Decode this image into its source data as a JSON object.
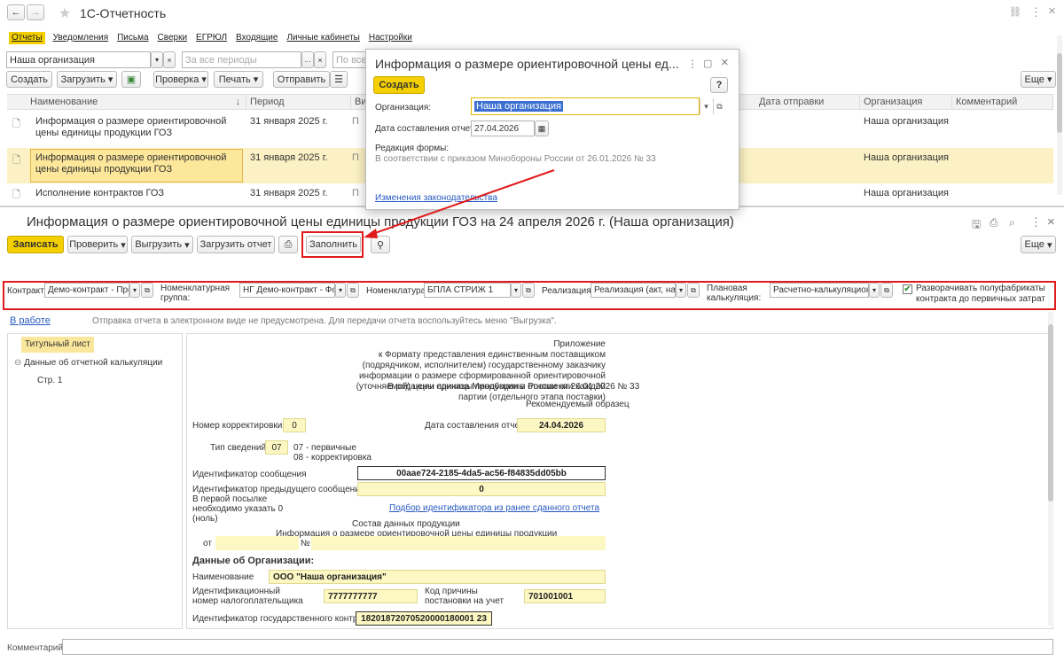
{
  "window": {
    "title": "1С-Отчетность",
    "nav_back": "←",
    "nav_forward": "→",
    "star": "★",
    "link_icon": "🔗",
    "more": "⋮",
    "close": "×"
  },
  "menu": [
    "Отчеты",
    "Уведомления",
    "Письма",
    "Сверки",
    "ЕГРЮЛ",
    "Входящие",
    "Личные кабинеты",
    "Настройки"
  ],
  "filters": {
    "org_value": "Наша организация",
    "period_placeholder": "За все периоды",
    "third_placeholder": "По всем"
  },
  "toolbar": {
    "create": "Создать",
    "load": "Загрузить",
    "check": "Проверка",
    "print": "Печать",
    "send": "Отправить",
    "more": "Еще"
  },
  "table": {
    "headers": {
      "name": "Наименование",
      "period": "Период",
      "type": "Вид",
      "sent": "Дата отправки",
      "org": "Организация",
      "comment": "Комментарий"
    },
    "rows": [
      {
        "name": "Информация о размере ориентировочной цены единицы продукции ГОЗ",
        "period": "31 января 2025 г.",
        "type": "П",
        "org": "Наша организация"
      },
      {
        "name": "Информация о размере ориентировочной цены единицы продукции ГОЗ",
        "period": "31 января 2025 г.",
        "type": "П",
        "org": "Наша организация"
      },
      {
        "name": "Исполнение контрактов ГОЗ",
        "period": "31 января 2025 г.",
        "type": "П",
        "org": "Наша организация"
      }
    ]
  },
  "dialog": {
    "title": "Информация о размере ориентировочной цены ед...",
    "create": "Создать",
    "help": "?",
    "org_label": "Организация:",
    "org_value": "Наша организация",
    "date_label": "Дата составления отчета:",
    "date_value": "27.04.2026",
    "edition_label": "Редакция формы:",
    "edition_text": "В соответствии с приказом Минобороны России от 26.01.2026 № 33",
    "law_link": "Изменения законодательства"
  },
  "report": {
    "title": "Информация о размере ориентировочной цены единицы продукции ГОЗ на 24 апреля 2026 г. (Наша организация)",
    "save": "Записать",
    "check": "Проверить",
    "export": "Выгрузить",
    "import": "Загрузить отчет",
    "fill": "Заполнить",
    "more": "Еще",
    "params": {
      "contract_label": "Контракт:",
      "contract_value": "Демо-контракт - Прои",
      "nomgroup_label": "Номенклатурная группа:",
      "nomgroup_value": "НГ Демо-контракт - Форі",
      "nom_label": "Номенклатура:",
      "nom_value": "БПЛА СТРИЖ 1",
      "real_label": "Реализация:",
      "real_value": "Реализация (акт, накл",
      "calc_label": "Плановая калькуляция:",
      "calc_value": "Расчетно-калькуляционн",
      "unfold_label": "Разворачивать полуфабрикаты контракта до первичных затрат"
    },
    "status_link": "В работе",
    "status_text": "Отправка отчета в электронном виде не предусмотрена. Для передачи отчета воспользуйтесь меню \"Выгрузка\".",
    "tree": {
      "title_page": "Титульный лист",
      "calc": "Данные об отчетной калькуляции",
      "page1": "Стр. 1"
    },
    "form": {
      "appendix": [
        "Приложение",
        "к Формату представления единственным поставщиком",
        "(подрядчиком, исполнителем) государственному заказчику",
        "информации о размере сформированной ориентировочной",
        "(уточняемой) цены единицы продукции в отношении каждой",
        "партии (отдельного этапа поставки)"
      ],
      "edition": "В редакции приказа Минобороны России от 26.01.2026 № 33",
      "recommended": "Рекомендуемый образец",
      "corr_label": "Номер корректировки",
      "corr_value": "0",
      "date_label": "Дата составления отчета",
      "date_value": "24.04.2026",
      "info_type_label": "Тип сведений",
      "info_type_value": "07",
      "info_type_note1": "07 - первичные",
      "info_type_note2": "08 - корректировка",
      "msg_id_label": "Идентификатор сообщения",
      "msg_id_value": "00aae724-2185-4da5-ac56-f84835dd05bb",
      "prev_id_label": "Идентификатор предыдущего сообщения",
      "prev_id_note": "В первой посылке необходимо указать 0 (ноль)",
      "prev_id_value": "0",
      "pick_link": "Подбор идентификатора из ранее сданного отчета",
      "composition1": "Состав данных продукции",
      "composition2": "Информация о размере ориентировочной цены единицы продукции",
      "from": "от",
      "num": "№",
      "org_section": "Данные об Организации:",
      "name_label": "Наименование",
      "name_value": "ООО \"Наша организация\"",
      "inn_label": "Идентификационный номер налогоплательщика",
      "inn_value": "7777777777",
      "kpp_label": "Код причины постановки на учет",
      "kpp_value": "701001001",
      "contract_id_label": "Идентификатор государственного контракта",
      "contract_id_value": "18201872070520000180001 23"
    }
  },
  "comment_label": "Комментарий:"
}
